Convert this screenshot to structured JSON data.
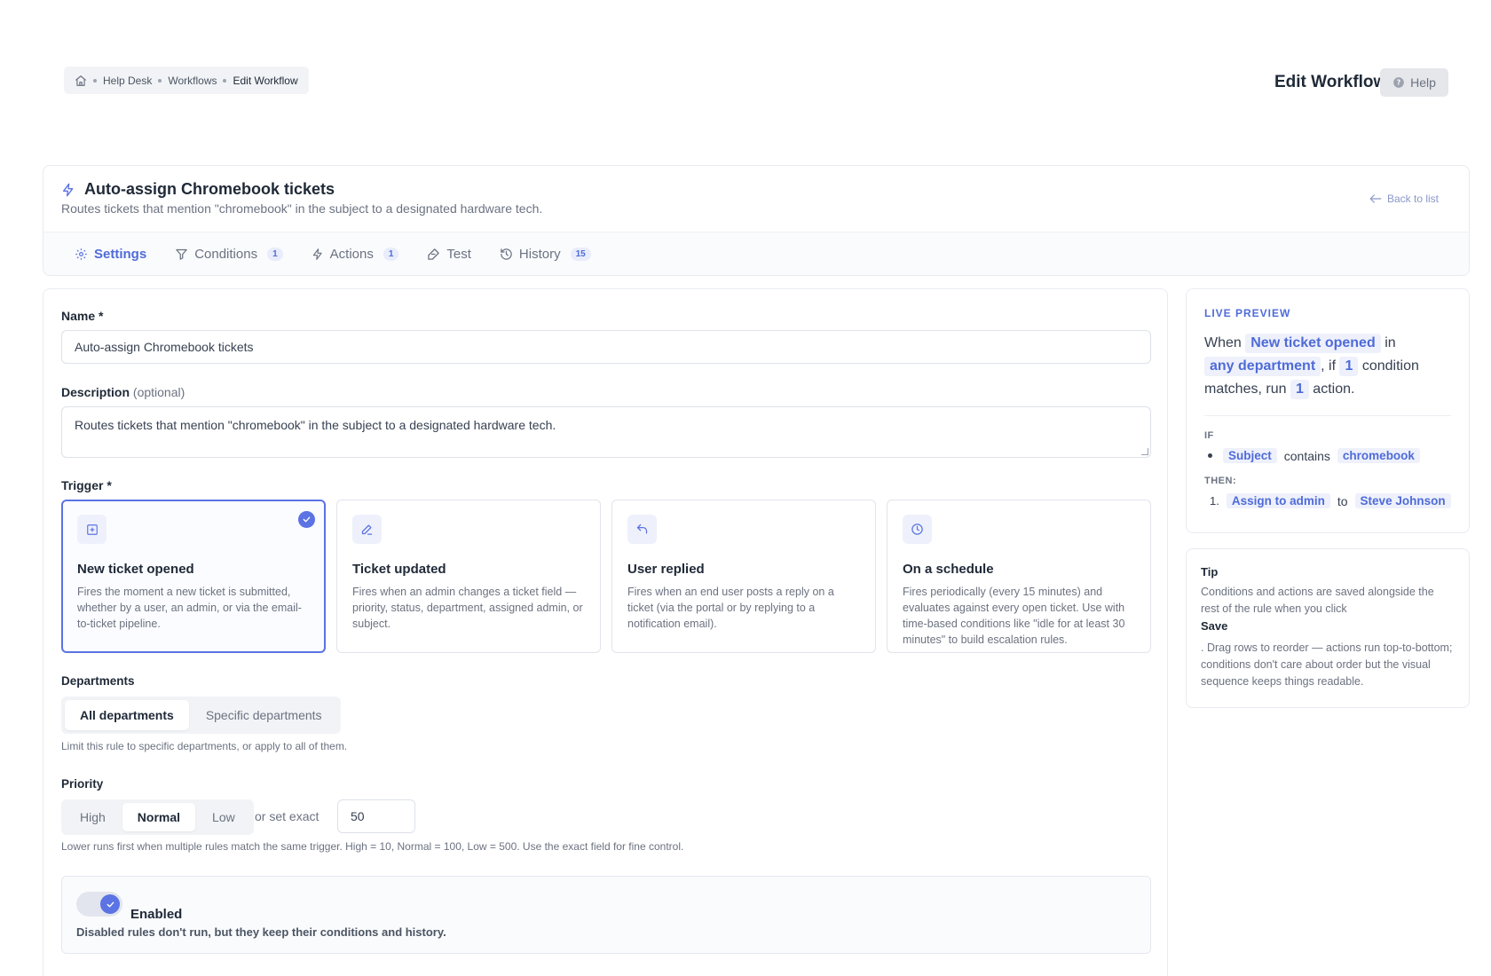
{
  "breadcrumb": {
    "items": [
      "Help Desk",
      "Workflows",
      "Edit Workflow"
    ]
  },
  "header": {
    "page_title": "Edit Workflow",
    "help_label": "Help"
  },
  "workflow": {
    "title": "Auto-assign Chromebook tickets",
    "subtitle": "Routes tickets that mention \"chromebook\" in the subject to a designated hardware tech.",
    "back_label": "Back to list"
  },
  "tabs": [
    {
      "label": "Settings",
      "badge": ""
    },
    {
      "label": "Conditions",
      "badge": "1"
    },
    {
      "label": "Actions",
      "badge": "1"
    },
    {
      "label": "Test",
      "badge": ""
    },
    {
      "label": "History",
      "badge": "15"
    }
  ],
  "form": {
    "name_label": "Name *",
    "name_value": "Auto-assign Chromebook tickets",
    "description_label": "Description",
    "description_optional": "(optional)",
    "description_value": "Routes tickets that mention \"chromebook\" in the subject to a designated hardware tech.",
    "trigger_label": "Trigger *",
    "triggers": [
      {
        "title": "New ticket opened",
        "desc": "Fires the moment a new ticket is submitted, whether by a user, an admin, or via the email-to-ticket pipeline.",
        "icon": "plus-square-icon",
        "selected": true
      },
      {
        "title": "Ticket updated",
        "desc": "Fires when an admin changes a ticket field — priority, status, department, assigned admin, or subject.",
        "icon": "edit-icon",
        "selected": false
      },
      {
        "title": "User replied",
        "desc": "Fires when an end user posts a reply on a ticket (via the portal or by replying to a notification email).",
        "icon": "reply-icon",
        "selected": false
      },
      {
        "title": "On a schedule",
        "desc": "Fires periodically (every 15 minutes) and evaluates against every open ticket. Use with time-based conditions like \"idle for at least 30 minutes\" to build escalation rules.",
        "icon": "clock-icon",
        "selected": false
      }
    ],
    "departments_label": "Departments",
    "departments_options": [
      "All departments",
      "Specific departments"
    ],
    "departments_selected": "All departments",
    "departments_help": "Limit this rule to specific departments, or apply to all of them.",
    "priority_label": "Priority",
    "priority_options": [
      "High",
      "Normal",
      "Low"
    ],
    "priority_selected": "Normal",
    "priority_exact_label": "or set exact",
    "priority_exact_value": "50",
    "priority_help": "Lower runs first when multiple rules match the same trigger. High = 10, Normal = 100, Low = 500. Use the exact field for fine control.",
    "enabled_label": "Enabled",
    "enabled_desc": "Disabled rules don't run, but they keep their conditions and history.",
    "enabled": true
  },
  "preview": {
    "heading": "LIVE PREVIEW",
    "when": "When",
    "trigger_chip": "New ticket opened",
    "in": "in",
    "department_chip": "any department",
    "if_text": ", if",
    "condition_count": "1",
    "condition_text": "condition matches, run",
    "action_count": "1",
    "action_text": "action.",
    "if_head": "IF",
    "condition_field": "Subject",
    "condition_op": "contains",
    "condition_value": "chromebook",
    "then_head": "THEN:",
    "action_index": "1.",
    "action_name": "Assign to admin",
    "action_to": "to",
    "action_target": "Steve Johnson"
  },
  "tip": {
    "title": "Tip",
    "text_before": "Conditions and actions are saved alongside the rest of the rule when you click",
    "strong": "Save",
    "text_after": ". Drag rows to reorder — actions run top-to-bottom; conditions don't care about order but the visual sequence keeps things readable."
  },
  "colors": {
    "accent": "#5b73e3",
    "accent_text": "#4f6bd8",
    "chip_bg": "#eef1fb"
  }
}
